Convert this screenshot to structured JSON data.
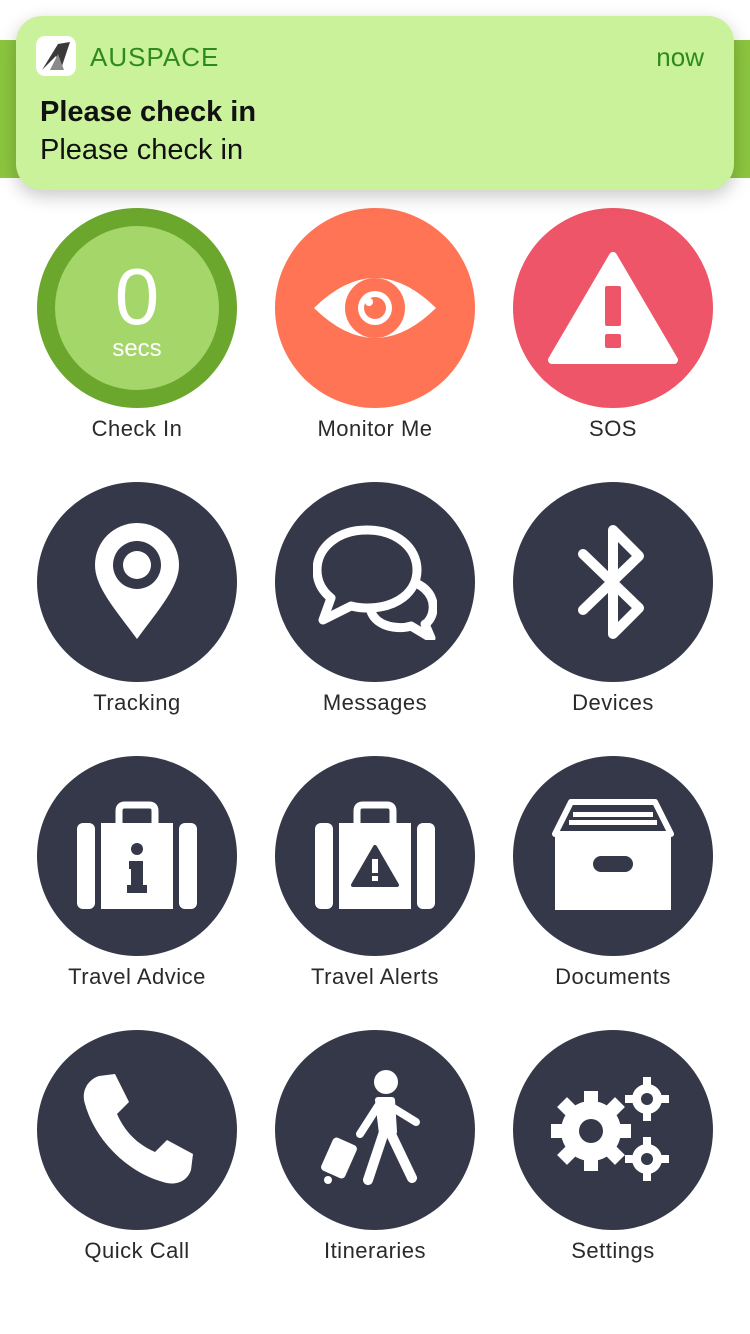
{
  "notification": {
    "app_name": "AUSPACE",
    "time": "now",
    "title": "Please check in",
    "body": "Please check in"
  },
  "check_in": {
    "count": "0",
    "unit": "secs",
    "label": "Check In"
  },
  "tiles": {
    "monitor_me": "Monitor Me",
    "sos": "SOS",
    "tracking": "Tracking",
    "messages": "Messages",
    "devices": "Devices",
    "travel_advice": "Travel Advice",
    "travel_alerts": "Travel Alerts",
    "documents": "Documents",
    "quick_call": "Quick Call",
    "itineraries": "Itineraries",
    "settings": "Settings"
  },
  "icons": {
    "app": "auspace-logo-icon",
    "monitor_me": "eye-icon",
    "sos": "warning-icon",
    "tracking": "location-pin-icon",
    "messages": "chat-bubbles-icon",
    "devices": "bluetooth-icon",
    "travel_advice": "suitcase-info-icon",
    "travel_alerts": "suitcase-warning-icon",
    "documents": "archive-box-icon",
    "quick_call": "phone-icon",
    "itineraries": "traveller-icon",
    "settings": "gears-icon"
  },
  "colors": {
    "tile_dark": "#353849",
    "monitor_orange": "#fe7455",
    "sos_red": "#ee5568",
    "checkin_green": "#6ca72d",
    "checkin_inner": "#a4d66a",
    "notification_bg": "#c9f29a",
    "header_green": "#8cc63f"
  }
}
